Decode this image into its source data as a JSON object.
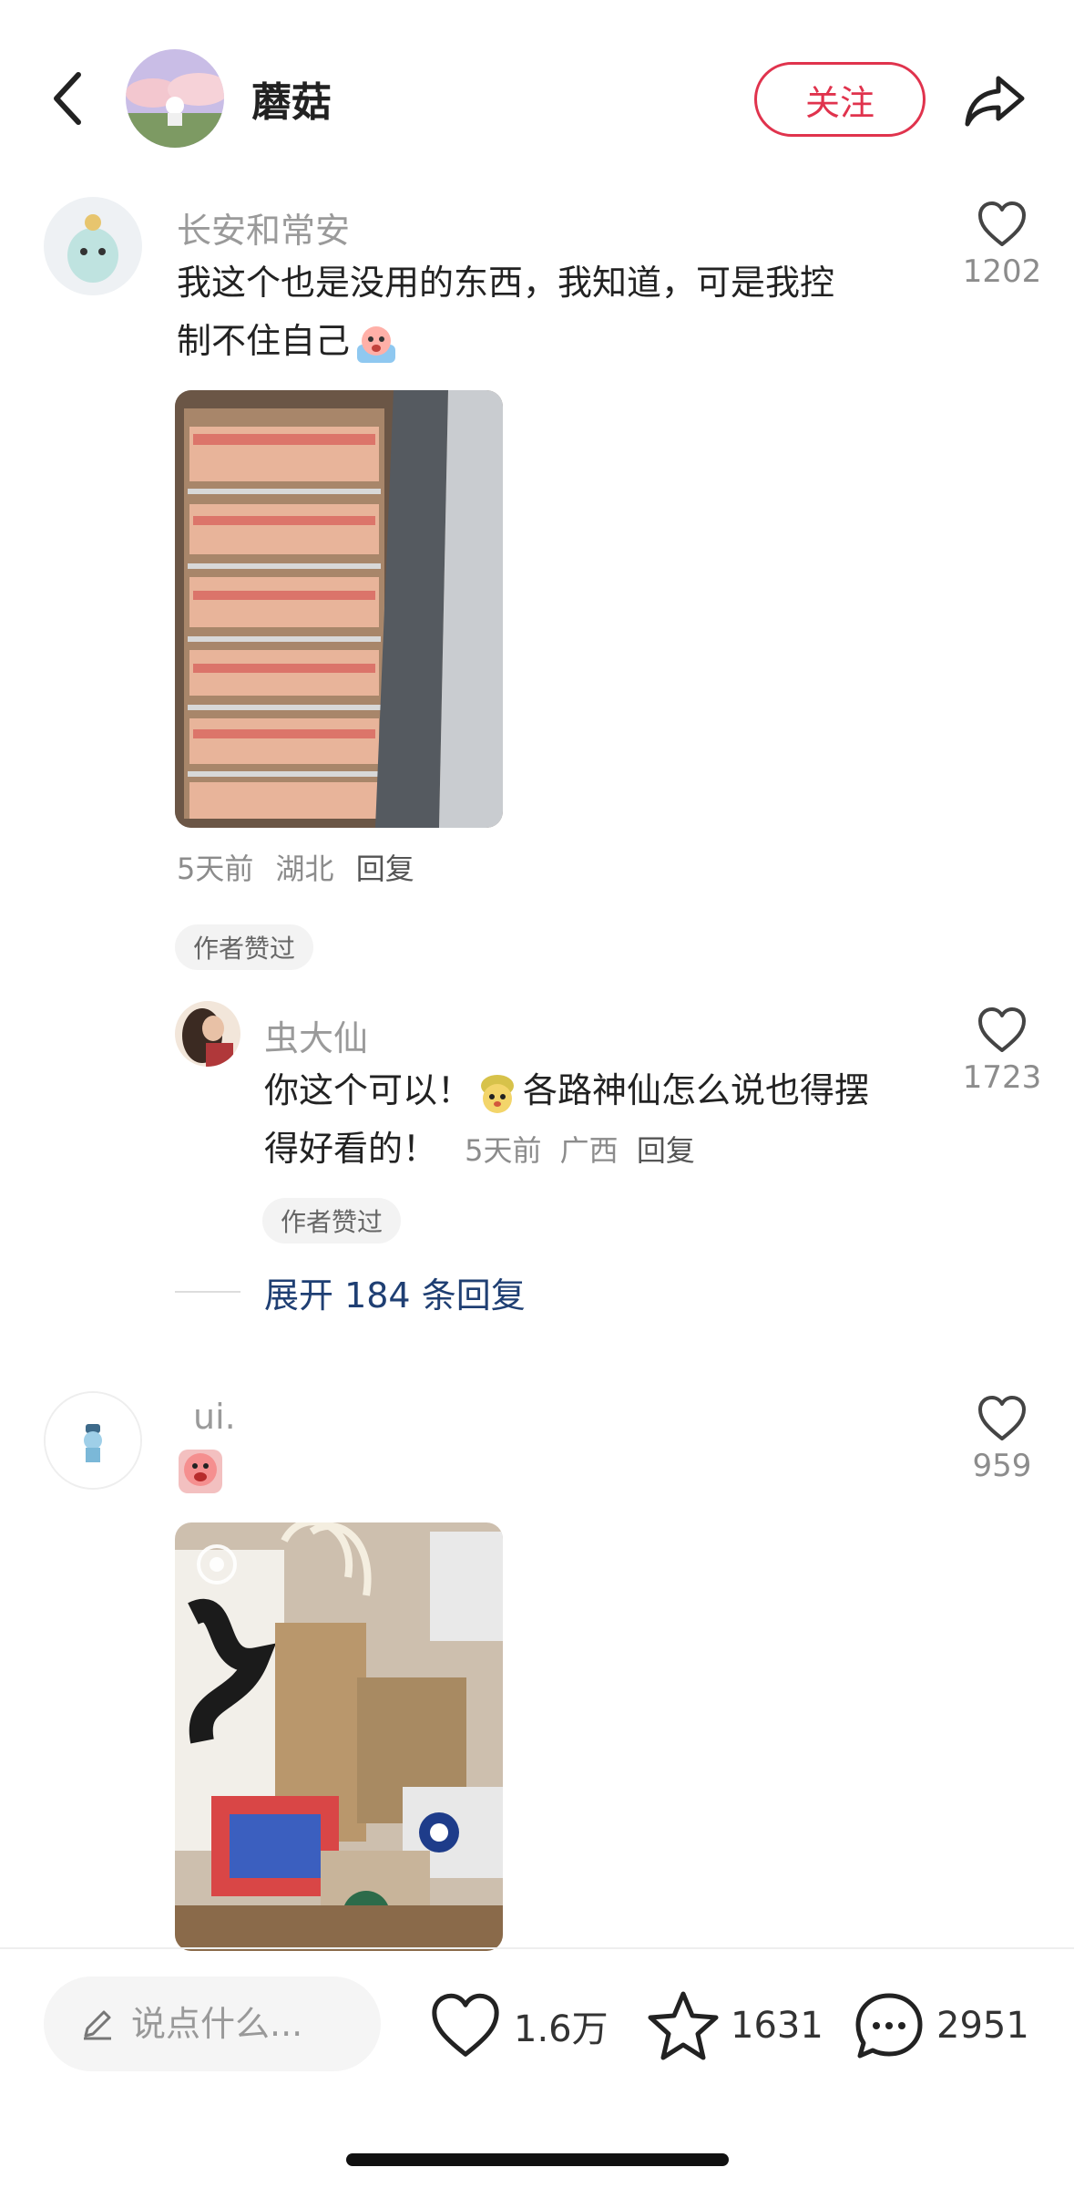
{
  "header": {
    "author_name": "蘑菇",
    "follow_label": "关注"
  },
  "comments": [
    {
      "username": "长安和常安",
      "text_line1": "我这个也是没用的东西，我知道，可是我控",
      "text_line2": "制不住自己",
      "likes": "1202",
      "time": "5天前",
      "location": "湖北",
      "reply_label": "回复",
      "badge": "作者赞过"
    },
    {
      "username": "虫大仙",
      "text_line1a": "你这个可以！",
      "text_line1b": "各路神仙怎么说也得摆",
      "text_line2": "得好看的！",
      "likes": "1723",
      "time": "5天前",
      "location": "广西",
      "reply_label": "回复",
      "badge": "作者赞过",
      "expand_label": "展开 184 条回复"
    },
    {
      "username": "ui.",
      "likes": "959"
    }
  ],
  "bottom_bar": {
    "input_placeholder": "说点什么...",
    "likes": "1.6万",
    "collects": "1631",
    "comments": "2951"
  },
  "colors": {
    "accent": "#e0334d",
    "expand_link": "#1f3f73",
    "muted": "#8c8c8c"
  }
}
